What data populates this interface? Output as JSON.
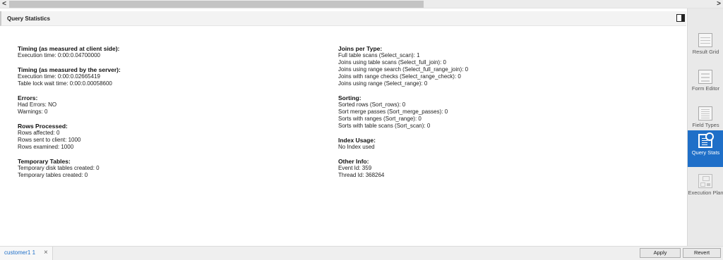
{
  "scrollbar": {
    "left_arrow": "<",
    "right_arrow": ">"
  },
  "panel": {
    "title": "Query Statistics"
  },
  "left_column": [
    {
      "heading": "Timing (as measured at client side):",
      "lines": [
        "Execution time: 0:00:0.04700000"
      ]
    },
    {
      "heading": "Timing (as measured by the server):",
      "lines": [
        "Execution time: 0:00:0.02665419",
        "Table lock wait time: 0:00:0.00058600"
      ]
    },
    {
      "heading": "Errors:",
      "lines": [
        "Had Errors: NO",
        "Warnings: 0"
      ]
    },
    {
      "heading": "Rows Processed:",
      "lines": [
        "Rows affected: 0",
        "Rows sent to client: 1000",
        "Rows examined: 1000"
      ]
    },
    {
      "heading": "Temporary Tables:",
      "lines": [
        "Temporary disk tables created: 0",
        "Temporary tables created: 0"
      ]
    }
  ],
  "right_column": [
    {
      "heading": "Joins per Type:",
      "lines": [
        "Full table scans (Select_scan): 1",
        "Joins using table scans (Select_full_join): 0",
        "Joins using range search (Select_full_range_join): 0",
        "Joins with range checks (Select_range_check): 0",
        "Joins using range (Select_range): 0"
      ]
    },
    {
      "heading": "Sorting:",
      "lines": [
        "Sorted rows (Sort_rows): 0",
        "Sort merge passes (Sort_merge_passes): 0",
        "Sorts with ranges (Sort_range): 0",
        "Sorts with table scans (Sort_scan): 0"
      ]
    },
    {
      "heading": "Index Usage:",
      "lines": [
        "No Index used"
      ]
    },
    {
      "heading": "Other Info:",
      "lines": [
        "Event Id: 359",
        "Thread Id: 368264"
      ]
    }
  ],
  "sidebar": {
    "items": [
      {
        "label": "Result Grid",
        "icon": "result-grid-icon",
        "active": false
      },
      {
        "label": "Form Editor",
        "icon": "form-editor-icon",
        "active": false
      },
      {
        "label": "Field Types",
        "icon": "field-types-icon",
        "active": false
      },
      {
        "label": "Query Stats",
        "icon": "query-stats-icon",
        "active": true
      },
      {
        "label": "Execution Plan",
        "icon": "execution-plan-icon",
        "active": false
      }
    ]
  },
  "bottom": {
    "tab_label": "customer1 1",
    "tab_close": "×",
    "apply_label": "Apply",
    "revert_label": "Revert"
  },
  "colors": {
    "accent": "#1f6fc8",
    "tab_text": "#1f6fc8"
  }
}
